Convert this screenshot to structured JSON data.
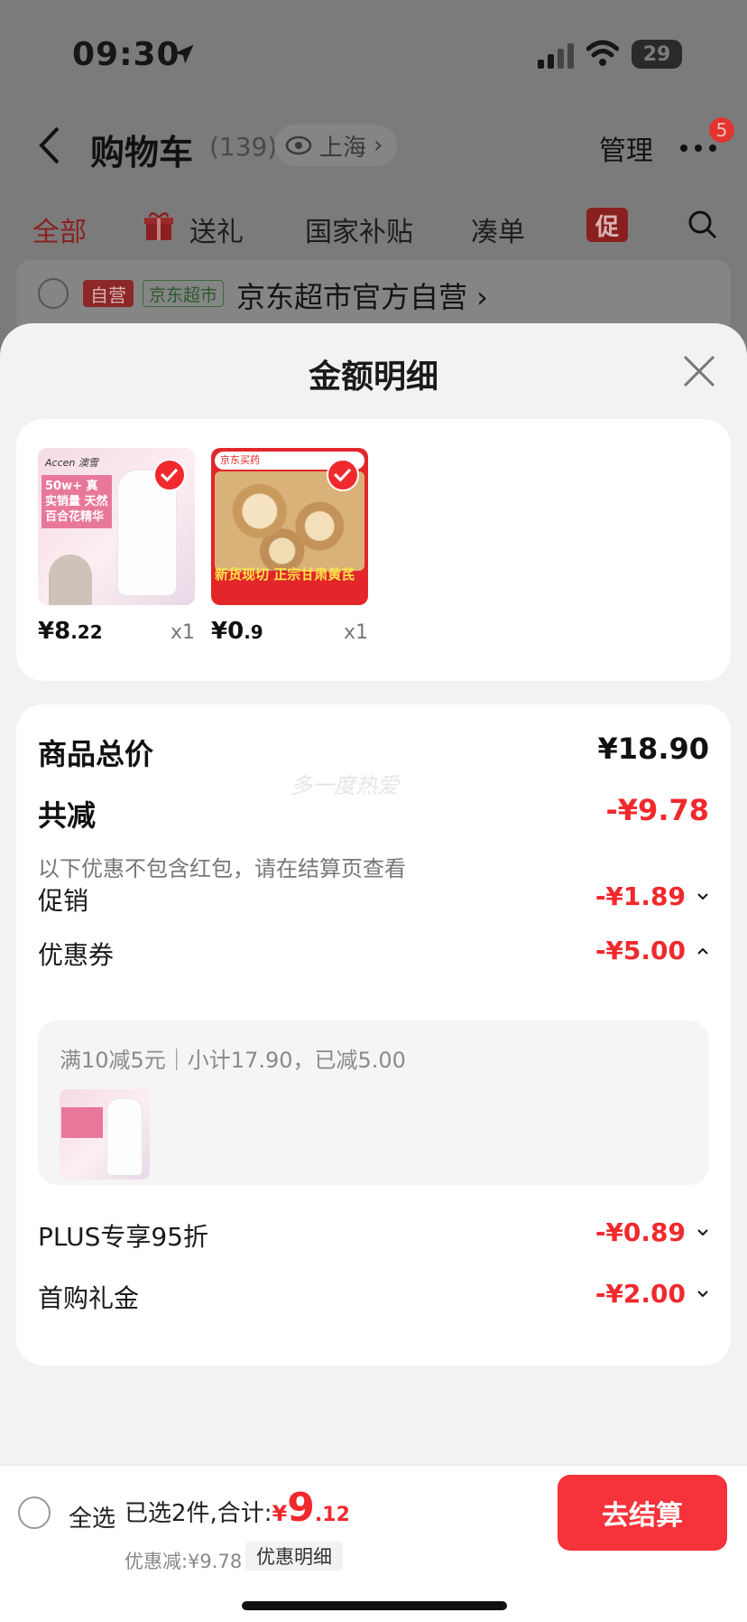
{
  "status_bar": {
    "time": "09:30",
    "battery": "29"
  },
  "nav": {
    "title": "购物车",
    "count": "(139)",
    "location": "上海",
    "manage": "管理",
    "badge": "5"
  },
  "tabs": [
    {
      "label": "全部"
    },
    {
      "label": "送礼"
    },
    {
      "label": "国家补贴"
    },
    {
      "label": "凑单"
    }
  ],
  "promo_tag": "促",
  "store": {
    "self_tag": "自营",
    "super_tag": "京东超市",
    "name": "京东超市官方自营 ›"
  },
  "sheet": {
    "title": "金额明细",
    "products": [
      {
        "price_int": "¥8",
        "price_dec": ".22",
        "qty": "x1",
        "img_text": "50w+ 真实销量 天然百合花精华",
        "brand": "Accen 澳雪"
      },
      {
        "price_int": "¥0",
        "price_dec": ".9",
        "qty": "x1",
        "img_text": "新货现切 正宗甘肃黄芪",
        "brand": "京东买药"
      }
    ],
    "watermark": "多一度热爱",
    "total": {
      "label": "商品总价",
      "value": "¥18.90"
    },
    "reduction": {
      "label": "共减",
      "value": "-¥9.78",
      "note": "以下优惠不包含红包，请在结算页查看"
    },
    "promo": {
      "label": "促销",
      "value": "-¥1.89"
    },
    "coupon": {
      "label": "优惠券",
      "value": "-¥5.00",
      "detail": "满10减5元｜小计17.90，已减5.00"
    },
    "plus": {
      "label": "PLUS专享95折",
      "value": "-¥0.89"
    },
    "first_gift": {
      "label": "首购礼金",
      "value": "-¥2.00"
    }
  },
  "bottom_bar": {
    "select_all": "全选",
    "selected": "已选2件,合计:",
    "total_yen": "¥",
    "total_int": "9",
    "total_dec": ".12",
    "saved": "优惠减:¥9.78",
    "detail_link": "优惠明细",
    "checkout": "去结算"
  },
  "colors": {
    "accent_red": "#f0292d",
    "checkout_red": "#f6323a",
    "sheet_bg": "#f2f2f4"
  }
}
